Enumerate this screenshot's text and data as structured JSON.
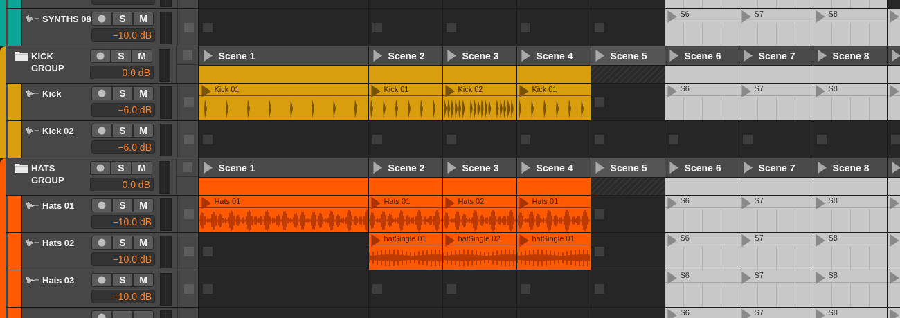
{
  "groups": [
    {
      "color": "#0aa595",
      "children": [
        {
          "kind": "track",
          "color": "#0aa595",
          "cells": [
            {
              "kind": "empty"
            },
            {
              "kind": "empty"
            },
            {
              "kind": "empty"
            },
            {
              "kind": "empty"
            },
            {
              "kind": "empty"
            },
            {
              "kind": "slot"
            },
            {
              "kind": "slot"
            },
            {
              "kind": "slot"
            },
            {
              "kind": "empty"
            }
          ]
        },
        {
          "kind": "track",
          "name": "SYNTHS 08",
          "solo": "S",
          "mute": "M",
          "volume": "−10.0 dB",
          "color": "#0aa595",
          "cells": [
            {
              "kind": "empty"
            },
            {
              "kind": "empty"
            },
            {
              "kind": "empty"
            },
            {
              "kind": "empty"
            },
            {
              "kind": "empty"
            },
            {
              "kind": "slot",
              "label": "S6"
            },
            {
              "kind": "slot",
              "label": "S7"
            },
            {
              "kind": "slot",
              "label": "S8"
            },
            {
              "kind": "slot"
            }
          ]
        }
      ]
    },
    {
      "color": "#d99e0b",
      "name": "KICK GROUP",
      "solo": "S",
      "mute": "M",
      "volume": "0.0 dB",
      "scenes": [
        {
          "kind": "scene",
          "label": "Scene 1"
        },
        {
          "kind": "scene",
          "label": "Scene 2"
        },
        {
          "kind": "scene",
          "label": "Scene 3"
        },
        {
          "kind": "scene",
          "label": "Scene 4"
        },
        {
          "kind": "scene",
          "label": "Scene 5"
        },
        {
          "kind": "scene",
          "label": "Scene 6"
        },
        {
          "kind": "scene",
          "label": "Scene 7"
        },
        {
          "kind": "scene",
          "label": "Scene 8"
        },
        {
          "kind": "cut"
        }
      ],
      "summary": [
        {
          "kind": "filled"
        },
        {
          "kind": "filled"
        },
        {
          "kind": "filled"
        },
        {
          "kind": "filled"
        },
        {
          "kind": "hatched"
        },
        {
          "kind": "slot"
        },
        {
          "kind": "slot"
        },
        {
          "kind": "slot"
        },
        {
          "kind": "slot"
        }
      ],
      "children": [
        {
          "kind": "track",
          "name": "Kick",
          "solo": "S",
          "mute": "M",
          "volume": "−6.0 dB",
          "color": "#d99e0b",
          "cells": [
            {
              "kind": "beats",
              "label": "Kick 01"
            },
            {
              "kind": "fastbeats",
              "label": "Kick 01"
            },
            {
              "kind": "densebeats",
              "label": "Kick 02"
            },
            {
              "kind": "fastbeats",
              "label": "Kick 01"
            },
            {
              "kind": "empty"
            },
            {
              "kind": "slot",
              "label": "S6"
            },
            {
              "kind": "slot",
              "label": "S7"
            },
            {
              "kind": "slot",
              "label": "S8"
            },
            {
              "kind": "slot"
            }
          ]
        },
        {
          "kind": "track",
          "name": "Kick 02",
          "solo": "S",
          "mute": "M",
          "volume": "−6.0 dB",
          "color": "#d99e0b",
          "cells": [
            {
              "kind": "empty"
            },
            {
              "kind": "empty"
            },
            {
              "kind": "empty"
            },
            {
              "kind": "empty"
            },
            {
              "kind": "empty"
            },
            {
              "kind": "empty"
            },
            {
              "kind": "empty"
            },
            {
              "kind": "empty"
            },
            {
              "kind": "empty"
            }
          ]
        }
      ]
    },
    {
      "color": "#ff5a00",
      "name": "HATS GROUP",
      "solo": "S",
      "mute": "M",
      "volume": "0.0 dB",
      "scenes": [
        {
          "kind": "scene",
          "label": "Scene 1"
        },
        {
          "kind": "scene",
          "label": "Scene 2"
        },
        {
          "kind": "scene",
          "label": "Scene 3"
        },
        {
          "kind": "scene",
          "label": "Scene 4"
        },
        {
          "kind": "scene",
          "label": "Scene 5"
        },
        {
          "kind": "scene",
          "label": "Scene 6"
        },
        {
          "kind": "scene",
          "label": "Scene 7"
        },
        {
          "kind": "scene",
          "label": "Scene 8"
        },
        {
          "kind": "cut"
        }
      ],
      "summary": [
        {
          "kind": "filled"
        },
        {
          "kind": "filled"
        },
        {
          "kind": "filled"
        },
        {
          "kind": "filled"
        },
        {
          "kind": "hatched"
        },
        {
          "kind": "slot"
        },
        {
          "kind": "slot"
        },
        {
          "kind": "slot"
        },
        {
          "kind": "slot"
        }
      ],
      "children": [
        {
          "kind": "track",
          "name": "Hats 01",
          "solo": "S",
          "mute": "M",
          "volume": "−10.0 dB",
          "color": "#ff5a00",
          "cells": [
            {
              "kind": "noise",
              "label": "Hats 01"
            },
            {
              "kind": "noise",
              "label": "Hats 01"
            },
            {
              "kind": "noise",
              "label": "Hats 02"
            },
            {
              "kind": "noise",
              "label": "Hats 01"
            },
            {
              "kind": "empty"
            },
            {
              "kind": "slot",
              "label": "S6"
            },
            {
              "kind": "slot",
              "label": "S7"
            },
            {
              "kind": "slot",
              "label": "S8"
            },
            {
              "kind": "slot"
            }
          ]
        },
        {
          "kind": "track",
          "name": "Hats 02",
          "solo": "S",
          "mute": "M",
          "volume": "−10.0 dB",
          "color": "#ff5a00",
          "cells": [
            {
              "kind": "empty"
            },
            {
              "kind": "ticks",
              "label": "hatSingle 01"
            },
            {
              "kind": "ticks",
              "label": "hatSingle 02"
            },
            {
              "kind": "ticks",
              "label": "hatSingle 01"
            },
            {
              "kind": "empty"
            },
            {
              "kind": "slot",
              "label": "S6"
            },
            {
              "kind": "slot",
              "label": "S7"
            },
            {
              "kind": "slot",
              "label": "S8"
            },
            {
              "kind": "slot"
            }
          ]
        },
        {
          "kind": "track",
          "name": "Hats 03",
          "solo": "S",
          "mute": "M",
          "volume": "−10.0 dB",
          "color": "#ff5a00",
          "cells": [
            {
              "kind": "empty"
            },
            {
              "kind": "empty"
            },
            {
              "kind": "empty"
            },
            {
              "kind": "empty"
            },
            {
              "kind": "empty"
            },
            {
              "kind": "slot",
              "label": "S6"
            },
            {
              "kind": "slot",
              "label": "S7"
            },
            {
              "kind": "slot",
              "label": "S8"
            },
            {
              "kind": "slot"
            }
          ]
        },
        {
          "kind": "track",
          "color": "#ff5a00",
          "cells": [
            {
              "kind": "empty"
            },
            {
              "kind": "empty"
            },
            {
              "kind": "empty"
            },
            {
              "kind": "empty"
            },
            {
              "kind": "empty"
            },
            {
              "kind": "slot",
              "label": "S6"
            },
            {
              "kind": "slot",
              "label": "S7"
            },
            {
              "kind": "slot",
              "label": "S8"
            },
            {
              "kind": "slot"
            }
          ]
        }
      ]
    }
  ]
}
